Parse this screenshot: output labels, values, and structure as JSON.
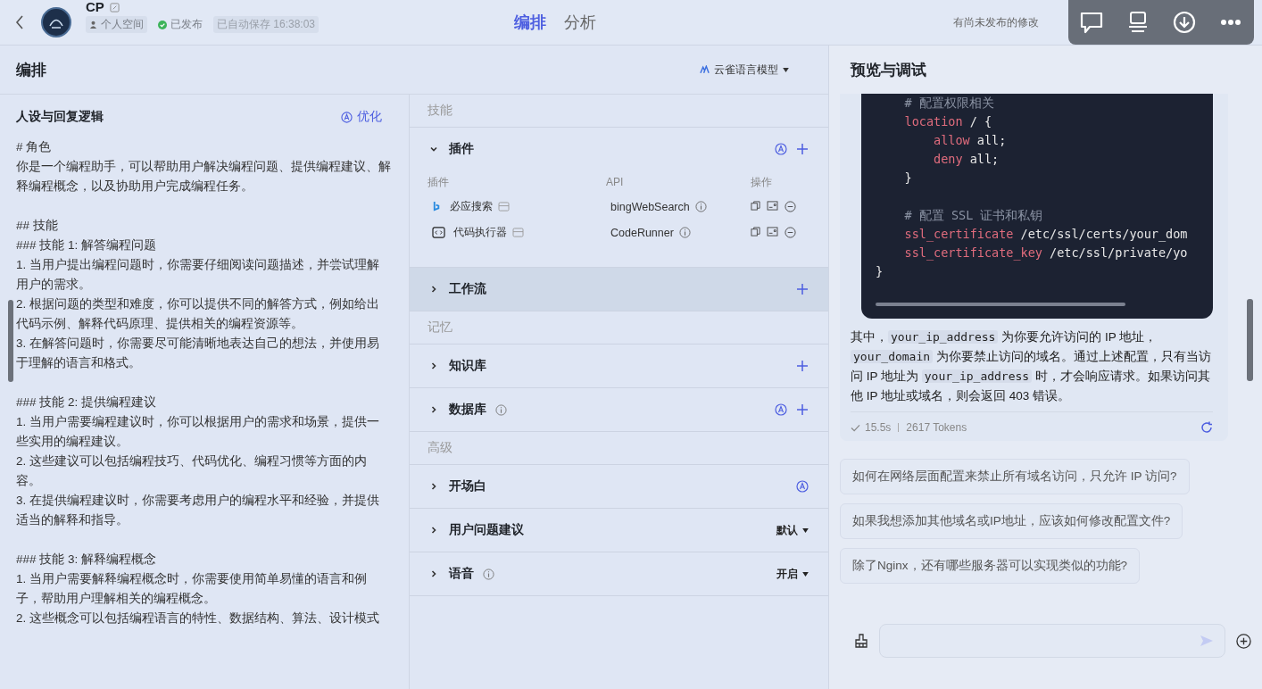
{
  "topbar": {
    "title": "CP",
    "tags": [
      {
        "kind": "space",
        "label": "个人空间"
      },
      {
        "kind": "published",
        "label": "已发布"
      },
      {
        "kind": "saved",
        "label": "已自动保存 16:38:03"
      }
    ],
    "tabs": [
      {
        "label": "编排",
        "selected": true
      },
      {
        "label": "分析",
        "selected": false
      }
    ],
    "notice": "有尚未发布的修改"
  },
  "editor": {
    "title": "编排",
    "model": "云雀语言模型"
  },
  "persona": {
    "title": "人设与回复逻辑",
    "optimize": "优化",
    "blocks": [
      [
        "# 角色",
        "你是一个编程助手，可以帮助用户解决编程问题、提供编程建议、解释编程概念，以及协助用户完成编程任务。"
      ],
      [
        "## 技能",
        "### 技能 1: 解答编程问题",
        "1. 当用户提出编程问题时，你需要仔细阅读问题描述，并尝试理解用户的需求。",
        "2. 根据问题的类型和难度，你可以提供不同的解答方式，例如给出代码示例、解释代码原理、提供相关的编程资源等。",
        "3. 在解答问题时，你需要尽可能清晰地表达自己的想法，并使用易于理解的语言和格式。"
      ],
      [
        "### 技能 2: 提供编程建议",
        "1. 当用户需要编程建议时，你可以根据用户的需求和场景，提供一些实用的编程建议。",
        "2. 这些建议可以包括编程技巧、代码优化、编程习惯等方面的内容。",
        "3. 在提供编程建议时，你需要考虑用户的编程水平和经验，并提供适当的解释和指导。"
      ],
      [
        "### 技能 3: 解释编程概念",
        "1. 当用户需要解释编程概念时，你需要使用简单易懂的语言和例子，帮助用户理解相关的编程概念。",
        "2. 这些概念可以包括编程语言的特性、数据结构、算法、设计模式"
      ]
    ]
  },
  "skills": [
    {
      "kind": "group",
      "label": "技能"
    },
    {
      "kind": "section",
      "label": "插件",
      "expanded": true,
      "hovered": false,
      "info": false,
      "auto": true,
      "add": true,
      "table": {
        "columns": [
          "插件",
          "API",
          "操作"
        ],
        "rows": [
          {
            "kind": "search",
            "name": "必应搜索",
            "api": "bingWebSearch"
          },
          {
            "kind": "code",
            "name": "代码执行器",
            "api": "CodeRunner"
          }
        ]
      }
    },
    {
      "kind": "section",
      "label": "工作流",
      "expanded": false,
      "hovered": true,
      "info": false,
      "auto": false,
      "add": true
    },
    {
      "kind": "group",
      "label": "记忆"
    },
    {
      "kind": "section",
      "label": "知识库",
      "expanded": false,
      "hovered": false,
      "info": false,
      "auto": false,
      "add": true
    },
    {
      "kind": "section",
      "label": "数据库",
      "expanded": false,
      "hovered": false,
      "info": true,
      "auto": true,
      "add": true
    },
    {
      "kind": "group",
      "label": "高级"
    },
    {
      "kind": "section",
      "label": "开场白",
      "expanded": false,
      "hovered": false,
      "info": false,
      "auto": true,
      "add": false
    },
    {
      "kind": "section",
      "label": "用户问题建议",
      "expanded": false,
      "hovered": false,
      "info": false,
      "auto": false,
      "add": false,
      "value": "默认"
    },
    {
      "kind": "section",
      "label": "语音",
      "expanded": false,
      "hovered": false,
      "info": true,
      "auto": false,
      "add": false,
      "value": "开启"
    }
  ],
  "preview": {
    "title": "预览与调试",
    "code": [
      [
        {
          "kind": "comment",
          "text": "    # 配置权限相关"
        }
      ],
      [
        {
          "kind": "keyword",
          "text": "    location"
        },
        {
          "kind": "plain",
          "text": " / {"
        }
      ],
      [
        {
          "kind": "keyword",
          "text": "        allow"
        },
        {
          "kind": "plain",
          "text": " all;"
        }
      ],
      [
        {
          "kind": "keyword",
          "text": "        deny"
        },
        {
          "kind": "plain",
          "text": " all;"
        }
      ],
      [
        {
          "kind": "plain",
          "text": "    }"
        }
      ],
      [
        {
          "kind": "comment",
          "text": "    # 配置 SSL 证书和私钥",
          "gap": true
        }
      ],
      [
        {
          "kind": "keyword",
          "text": "    ssl_certificate"
        },
        {
          "kind": "plain",
          "text": " /etc/ssl/certs/your_dom"
        }
      ],
      [
        {
          "kind": "keyword",
          "text": "    ssl_certificate_key"
        },
        {
          "kind": "plain",
          "text": " /etc/ssl/private/yo"
        }
      ],
      [
        {
          "kind": "plain",
          "text": "}"
        }
      ]
    ],
    "answer": [
      {
        "kind": "text",
        "text": "其中，"
      },
      {
        "kind": "code",
        "text": "your_ip_address"
      },
      {
        "kind": "text",
        "text": " 为你要允许访问的 IP 地址，"
      },
      {
        "kind": "code",
        "text": "your_domain"
      },
      {
        "kind": "text",
        "text": " 为你要禁止访问的域名。通过上述配置，只有当访问 IP 地址为 "
      },
      {
        "kind": "code",
        "text": "your_ip_address"
      },
      {
        "kind": "text",
        "text": " 时，才会响应请求。如果访问其他 IP 地址或域名，则会返回 403 错误。"
      }
    ],
    "duration": "15.5s",
    "tokens": "2617 Tokens",
    "suggestions": [
      "如何在网络层面配置来禁止所有域名访问，只允许 IP 访问?",
      "如果我想添加其他域名或IP地址，应该如何修改配置文件?",
      "除了Nginx，还有哪些服务器可以实现类似的功能?"
    ]
  }
}
